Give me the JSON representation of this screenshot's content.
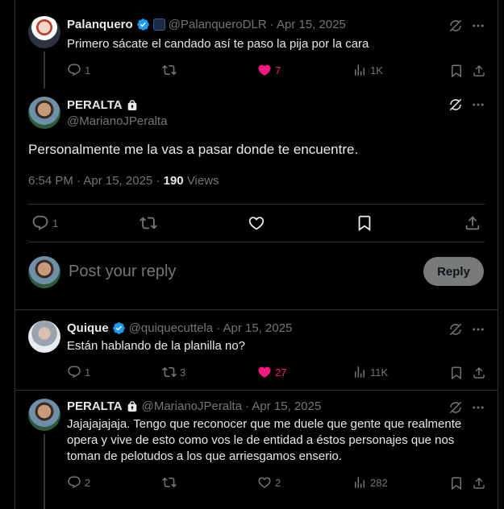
{
  "colors": {
    "like": "#f91880",
    "verified": "#1d9bf0",
    "muted": "#71767b"
  },
  "tweet1": {
    "name": "Palanquero",
    "handle": "@PalanqueroDLR",
    "date": "· Apr 15, 2025",
    "text": "Primero sácate el candado así te paso la pija por la cara",
    "replies": "1",
    "likes": "7",
    "views": "1K"
  },
  "main": {
    "name": "PERALTA",
    "handle": "@MarianoJPeralta",
    "text": "Personalmente me la vas a pasar donde te encuentre.",
    "time": "6:54 PM · Apr 15, 2025 ·",
    "views_count": "190",
    "views_label": "Views",
    "replies": "1"
  },
  "reply_box": {
    "placeholder": "Post your reply",
    "button": "Reply"
  },
  "tweet2": {
    "name": "Quique",
    "handle": "@quiquecuttela",
    "date": "· Apr 15, 2025",
    "text": "Están hablando de la planilla no?",
    "replies": "1",
    "reposts": "3",
    "likes": "27",
    "views": "11K"
  },
  "tweet3": {
    "name": "PERALTA",
    "handle": "@MarianoJPeralta",
    "date": "· Apr 15, 2025",
    "text_lines": [
      "Jajajajajaja. Tengo que reconocer que me duele que gente que realmente",
      "opera y vive de esto como vos le de entidad a éstos personajes que nos",
      "toman de pelotudos a los que arriesgamos enserio."
    ],
    "replies": "2",
    "likes": "2",
    "views": "282"
  }
}
